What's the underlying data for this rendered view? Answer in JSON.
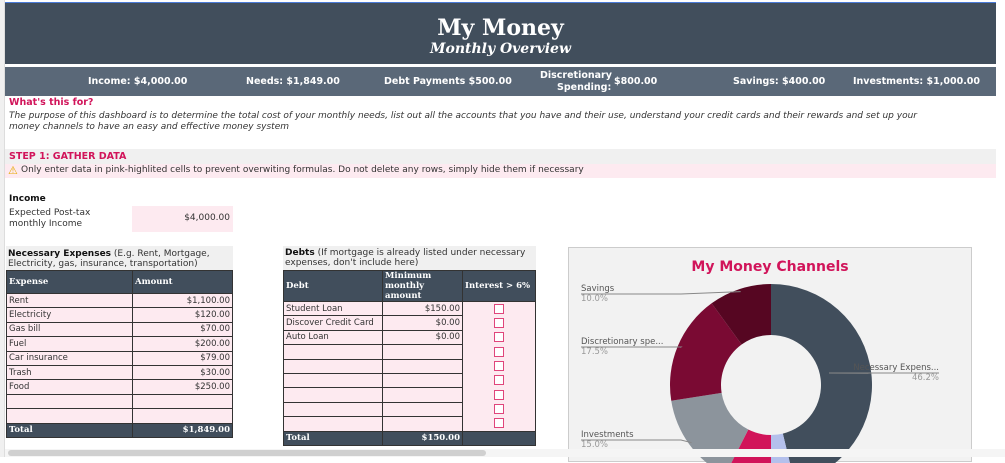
{
  "header": {
    "title": "My Money",
    "subtitle": "Monthly Overview"
  },
  "summary": {
    "income": "Income: $4,000.00",
    "needs": "Needs: $1,849.00",
    "debt": "Debt Payments $500.00",
    "disc_label_1": "Discretionary",
    "disc_label_2": "Spending:",
    "disc_value": "$800.00",
    "savings": "Savings: $400.00",
    "investments": "Investments: $1,000.00"
  },
  "intro": {
    "heading": "What's this for?",
    "text": "The purpose of this dashboard is to determine the total cost of your monthly needs, list out all the accounts that you have and their use, understand your credit cards and their rewards and set up your money channels to have an easy and effective money system"
  },
  "step1": {
    "heading": "STEP 1: GATHER DATA",
    "warning": "Only enter data in pink-highlited cells to prevent overwiting formulas. Do not delete any rows, simply hide them if necessary"
  },
  "income": {
    "heading": "Income",
    "label": "Expected Post-tax monthly Income",
    "value": "$4,000.00"
  },
  "expenses": {
    "title": "Necessary Expenses",
    "hint": "(E.g. Rent, Mortgage, Electricity, gas, insurance, transportation)",
    "col_expense": "Expense",
    "col_amount": "Amount",
    "rows": [
      {
        "name": "Rent",
        "amount": "$1,100.00"
      },
      {
        "name": "Electricity",
        "amount": "$120.00"
      },
      {
        "name": "Gas bill",
        "amount": "$70.00"
      },
      {
        "name": "Fuel",
        "amount": "$200.00"
      },
      {
        "name": "Car insurance",
        "amount": "$79.00"
      },
      {
        "name": "Trash",
        "amount": "$30.00"
      },
      {
        "name": "Food",
        "amount": "$250.00"
      },
      {
        "name": "",
        "amount": ""
      },
      {
        "name": "",
        "amount": ""
      }
    ],
    "total_label": "Total",
    "total": "$1,849.00"
  },
  "debts": {
    "title": "Debts",
    "hint": "(If mortgage is already listed under necessary expenses, don't include here)",
    "col_debt": "Debt",
    "col_min": "Minimum monthly amount",
    "col_interest": "Interest > 6%",
    "rows": [
      {
        "name": "Student Loan",
        "amount": "$150.00"
      },
      {
        "name": "Discover Credit Card",
        "amount": "$0.00"
      },
      {
        "name": "Auto Loan",
        "amount": "$0.00"
      },
      {
        "name": "",
        "amount": ""
      },
      {
        "name": "",
        "amount": ""
      },
      {
        "name": "",
        "amount": ""
      },
      {
        "name": "",
        "amount": ""
      },
      {
        "name": "",
        "amount": ""
      },
      {
        "name": "",
        "amount": ""
      }
    ],
    "total_label": "Total",
    "total": "$150.00"
  },
  "chart_data": {
    "type": "pie",
    "title": "My Money Channels",
    "slices": [
      {
        "label": "Necessary Expens...",
        "pct_label": "46.2%",
        "value": 46.2,
        "color": "#414e5c"
      },
      {
        "label": "",
        "pct_label": "",
        "value": 3.8,
        "color": "#b4c0ec"
      },
      {
        "label": "",
        "pct_label": "",
        "value": 7.5,
        "color": "#d1145a"
      },
      {
        "label": "Investments",
        "pct_label": "15.0%",
        "value": 15.0,
        "color": "#8c949c"
      },
      {
        "label": "Discretionary spe...",
        "pct_label": "17.5%",
        "value": 17.5,
        "color": "#7a0a33"
      },
      {
        "label": "Savings",
        "pct_label": "10.0%",
        "value": 10.0,
        "color": "#560622"
      }
    ]
  }
}
